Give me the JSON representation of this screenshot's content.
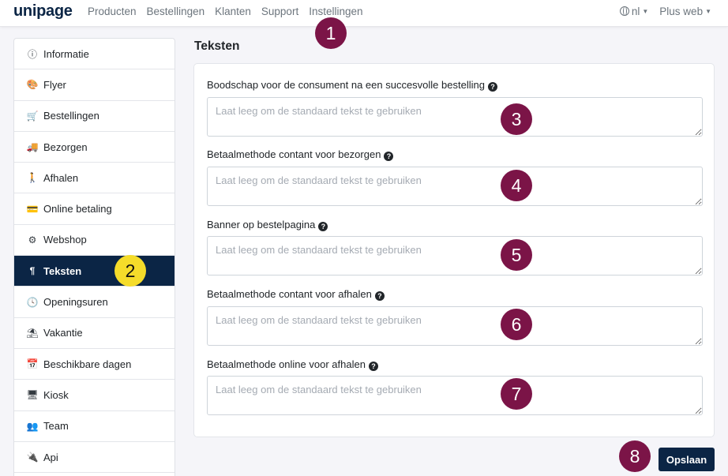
{
  "brand": {
    "logo": "unipage"
  },
  "nav": {
    "links": [
      "Producten",
      "Bestellingen",
      "Klanten",
      "Support",
      "Instellingen"
    ],
    "language": "nl",
    "plan": "Plus web"
  },
  "sidebar": {
    "items": [
      {
        "label": "Informatie",
        "icon": "info-circle-icon",
        "glyph": "ⓘ"
      },
      {
        "label": "Flyer",
        "icon": "palette-icon",
        "glyph": "🎨"
      },
      {
        "label": "Bestellingen",
        "icon": "cart-icon",
        "glyph": "🛒"
      },
      {
        "label": "Bezorgen",
        "icon": "truck-icon",
        "glyph": "🚚"
      },
      {
        "label": "Afhalen",
        "icon": "walking-icon",
        "glyph": "🚶"
      },
      {
        "label": "Online betaling",
        "icon": "credit-card-icon",
        "glyph": "💳"
      },
      {
        "label": "Webshop",
        "icon": "cogs-icon",
        "glyph": "⚙"
      },
      {
        "label": "Teksten",
        "icon": "paragraph-icon",
        "glyph": "¶",
        "active": true
      },
      {
        "label": "Openingsuren",
        "icon": "clock-icon",
        "glyph": "🕓"
      },
      {
        "label": "Vakantie",
        "icon": "umbrella-beach-icon",
        "glyph": "⛱"
      },
      {
        "label": "Beschikbare dagen",
        "icon": "calendar-plus-icon",
        "glyph": "📅"
      },
      {
        "label": "Kiosk",
        "icon": "desktop-icon",
        "glyph": "🖥"
      },
      {
        "label": "Team",
        "icon": "users-icon",
        "glyph": "👥"
      },
      {
        "label": "Api",
        "icon": "plug-icon",
        "glyph": "🔌"
      }
    ]
  },
  "main": {
    "title": "Teksten",
    "placeholder": "Laat leeg om de standaard tekst te gebruiken",
    "fields": [
      {
        "label": "Boodschap voor de consument na een succesvolle bestelling",
        "value": ""
      },
      {
        "label": "Betaalmethode contant voor bezorgen",
        "value": ""
      },
      {
        "label": "Banner op bestelpagina",
        "value": ""
      },
      {
        "label": "Betaalmethode contant voor afhalen",
        "value": ""
      },
      {
        "label": "Betaalmethode online voor afhalen",
        "value": ""
      }
    ],
    "save_label": "Opslaan"
  },
  "annotations": [
    "1",
    "2",
    "3",
    "4",
    "5",
    "6",
    "7",
    "8"
  ],
  "colors": {
    "primary": "#0b2545",
    "badge": "#7b1447",
    "badge_highlight": "#f5dc2a"
  }
}
